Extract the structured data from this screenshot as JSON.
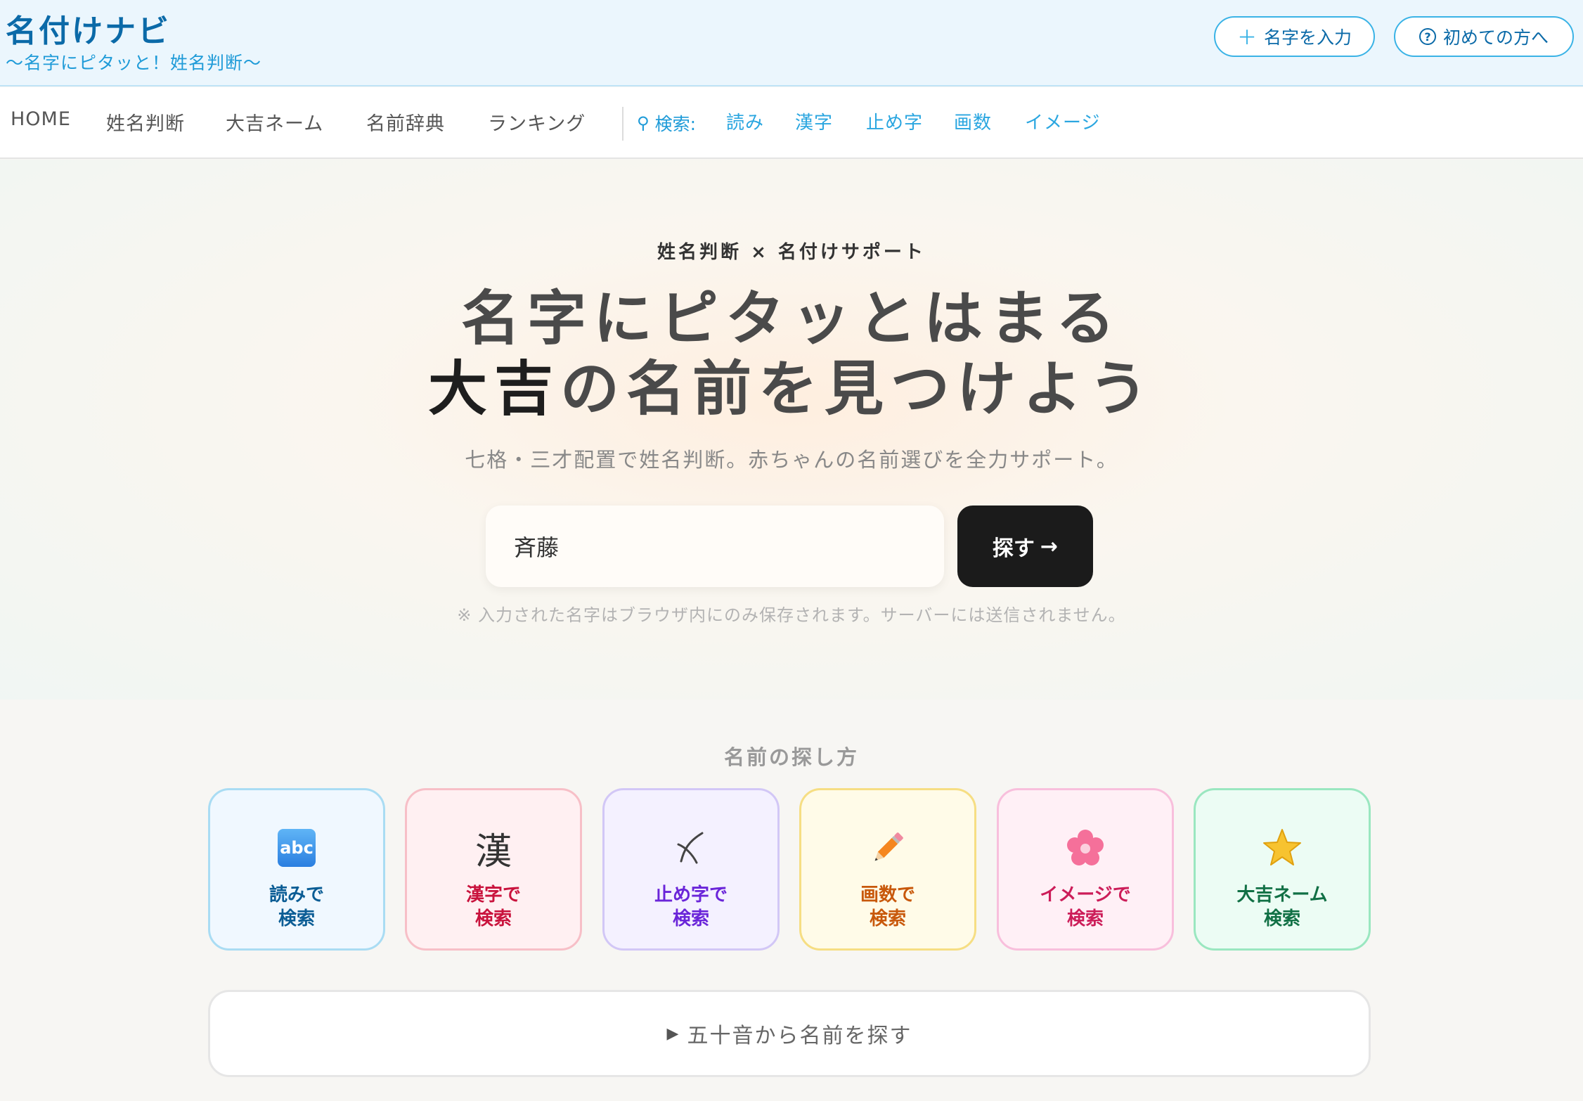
{
  "header": {
    "title": "名付けナビ",
    "subtitle": "〜名字にピタッと！姓名判断〜",
    "add_surname_label": "名字を入力",
    "first_time_label": "初めての方へ"
  },
  "nav": {
    "items": [
      {
        "label": "HOME"
      },
      {
        "label": "姓名判断"
      },
      {
        "label": "大吉ネーム"
      },
      {
        "label": "名前辞典"
      },
      {
        "label": "ランキング"
      }
    ],
    "search_label": "検索:",
    "search_links": [
      {
        "label": "読み"
      },
      {
        "label": "漢字"
      },
      {
        "label": "止め字"
      },
      {
        "label": "画数"
      },
      {
        "label": "イメージ"
      }
    ]
  },
  "hero": {
    "kicker": "姓名判断 × 名付けサポート",
    "headline_line1": "名字にピタッとはまる",
    "headline_accent": "大吉",
    "headline_line2_rest": "の名前を見つけよう",
    "lead": "七格・三才配置で姓名判断。赤ちゃんの名前選びを全力サポート。",
    "input_value": "斉藤",
    "search_button": "探す",
    "note": "※ 入力された名字はブラウザ内にのみ保存されます。サーバーには送信されません。"
  },
  "howto": {
    "title": "名前の探し方",
    "cards": [
      {
        "label": "読みで\n検索",
        "icon": "abc-icon",
        "icon_text": "abc"
      },
      {
        "label": "漢字で\n検索",
        "icon": "kanji-icon",
        "icon_text": "漢"
      },
      {
        "label": "止め字で\n検索",
        "icon": "ending-char-icon",
        "icon_text": "〆"
      },
      {
        "label": "画数で\n検索",
        "icon": "pencil-icon",
        "icon_text": "✏️"
      },
      {
        "label": "イメージで\n検索",
        "icon": "cherry-blossom-icon",
        "icon_text": "🌸"
      },
      {
        "label": "大吉ネーム\n検索",
        "icon": "star-icon",
        "icon_text": "⭐"
      }
    ],
    "gojuon_label": "五十音から名前を探す"
  },
  "colors": {
    "brand": "#0b6aa8",
    "accent": "#1f9bd8",
    "button_dark": "#1b1b1b"
  }
}
